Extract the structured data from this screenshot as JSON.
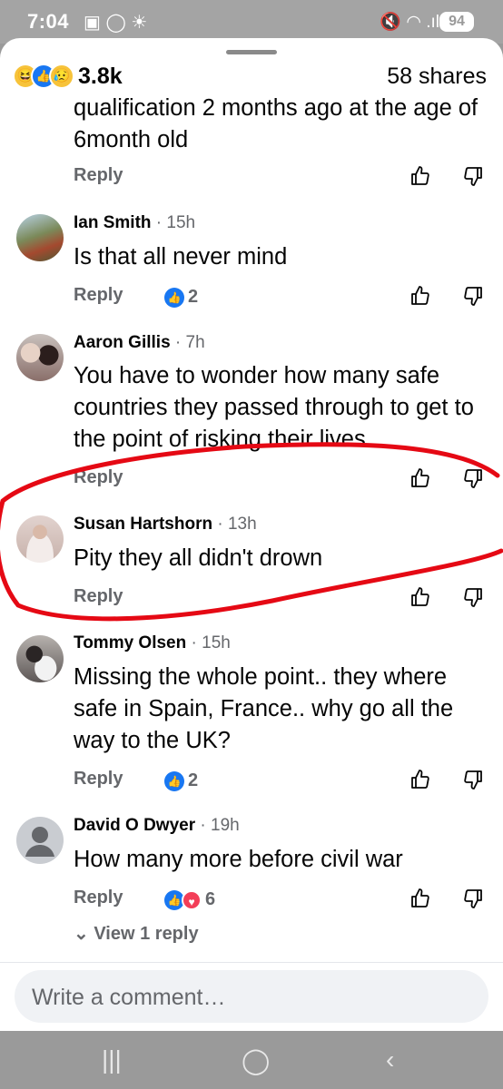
{
  "status": {
    "time": "7:04",
    "battery": "94",
    "left_icons": "▣ ◯ ☀",
    "right_icons": "🔇 ◠ .ıl"
  },
  "post": {
    "reaction_count": "3.8k",
    "shares": "58 shares"
  },
  "comments": [
    {
      "name": "",
      "time": "",
      "text": "qualification 2 months ago at the age of 6month old",
      "reactions": ""
    },
    {
      "name": "Ian Smith",
      "time": "· 15h",
      "text": "Is that all never mind",
      "reactions": "2"
    },
    {
      "name": "Aaron Gillis",
      "time": "· 7h",
      "text": "You have to wonder how many safe countries they passed through to get to the point of risking their lives",
      "reactions": ""
    },
    {
      "name": "Susan Hartshorn",
      "time": "· 13h",
      "text": "Pity they all didn't drown",
      "reactions": ""
    },
    {
      "name": "Tommy Olsen",
      "time": "· 15h",
      "text": "Missing the whole point.. they where safe in Spain, France.. why go all the way to the UK?",
      "reactions": "2"
    },
    {
      "name": "David O Dwyer",
      "time": "· 19h",
      "text": "How many more before civil war",
      "reactions": "6"
    }
  ],
  "reply_label": "Reply",
  "view_replies": "View 1 reply",
  "composer": {
    "placeholder": "Write a comment…"
  },
  "icons": [
    "haha-icon",
    "like-icon",
    "sad-icon",
    "thumb-up-icon",
    "thumb-down-icon",
    "love-icon",
    "chevron-down-icon"
  ],
  "colors": {
    "accent": "#1877f2",
    "love": "#f33e58",
    "annotation": "#e50914",
    "secondary_text": "#65676b"
  }
}
